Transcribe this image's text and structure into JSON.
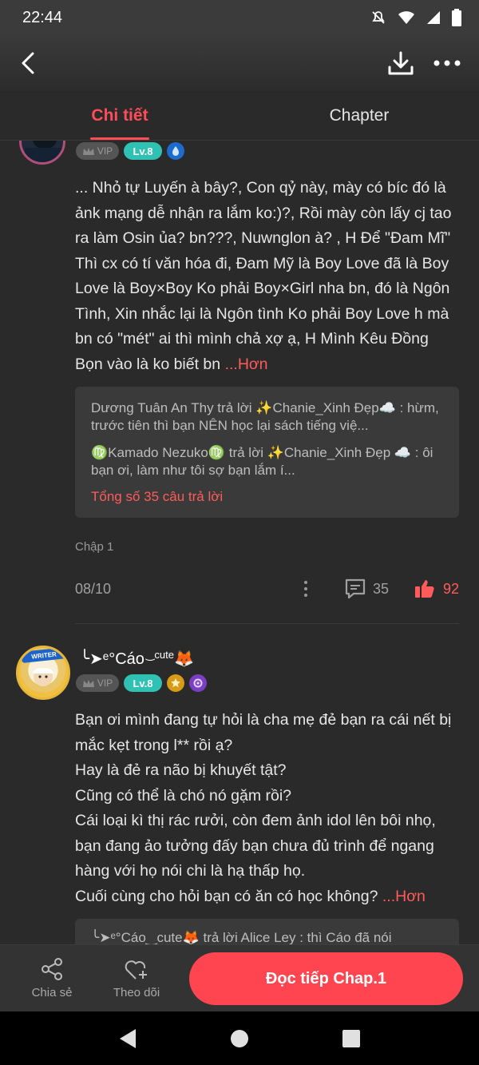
{
  "status_bar": {
    "time": "22:44"
  },
  "tabs": [
    {
      "label": "Chi tiết",
      "active": true
    },
    {
      "label": "Chapter",
      "active": false
    }
  ],
  "comment1": {
    "vip_label": "VIP",
    "level": "Lv.8",
    "text": "... Nhỏ tự Luyến à bây?, Con qỷ này, mày có bíc đó là ảnk mạng dễ nhận ra lắm ko:)?, Rồi mày còn lấy cj tao ra làm Osin ủa? bn???, Nuwnglon à? , H Để \"Đam Mĩ\" Thì cx có tí văn hóa đi, Đam Mỹ là Boy Love đã là Boy Love là Boy×Boy Ko phải Boy×Girl nha bn, đó là Ngôn Tình, Xin nhắc lại là Ngôn tình Ko phải Boy Love h mà bn có \"mét\" ai thì mình chả xợ ạ, H Mình Kêu Đồng Bọn vào là ko biết bn",
    "more_label": "...Hơn",
    "replies": [
      "Dương Tuân An Thy trả lời ✨Chanie_Xinh Đẹp☁️ : hừm, trước tiên thì bạn NÊN học lại sách tiếng việ...",
      "♍Kamado Nezuko♍ trả lời ✨Chanie_Xinh Đẹp ☁️ : ôi bạn ơi, làm như tôi sợ bạn lắm í..."
    ],
    "replies_total": "Tổng số 35 câu trả lời",
    "chapter": "Chập 1",
    "date": "08/10",
    "comment_count": "35",
    "like_count": "92"
  },
  "comment2": {
    "avatar_badge": "WRITER",
    "username_prefix": "╰➤ᵉ°Cáo",
    "username_sup": "‿cute",
    "username_suffix": "🦊",
    "vip_label": "VIP",
    "level": "Lv.8",
    "lines": [
      "Bạn ơi mình đang tự hỏi là cha mẹ đẻ bạn ra cái nết bị mắc kẹt trong l** rồi ạ?",
      "Hay là đẻ ra não bị khuyết tật?",
      "Cũng có thể là chó nó gặm rồi?",
      "Cái loại kì thị rác rưởi, còn đem ảnh idol lên bôi nhọ, bạn đang ảo tưởng đấy bạn chưa đủ trình để ngang hàng với họ nói chi là hạ thấp họ.",
      "Cuối cùng cho hỏi bạn có ăn có học không?"
    ],
    "more_label": "...Hơn",
    "reply_peek": "╰➤ᵉ°Cáo‿cute🦊 trả lời Alice Ley : thì Cáo đã nói"
  },
  "bottom_bar": {
    "share_label": "Chia sẻ",
    "follow_label": "Theo dõi",
    "read_label": "Đọc tiếp Chap.1"
  },
  "colors": {
    "accent": "#ff4650",
    "level_badge": "#2fc1b4",
    "background": "#2a2a2a"
  }
}
